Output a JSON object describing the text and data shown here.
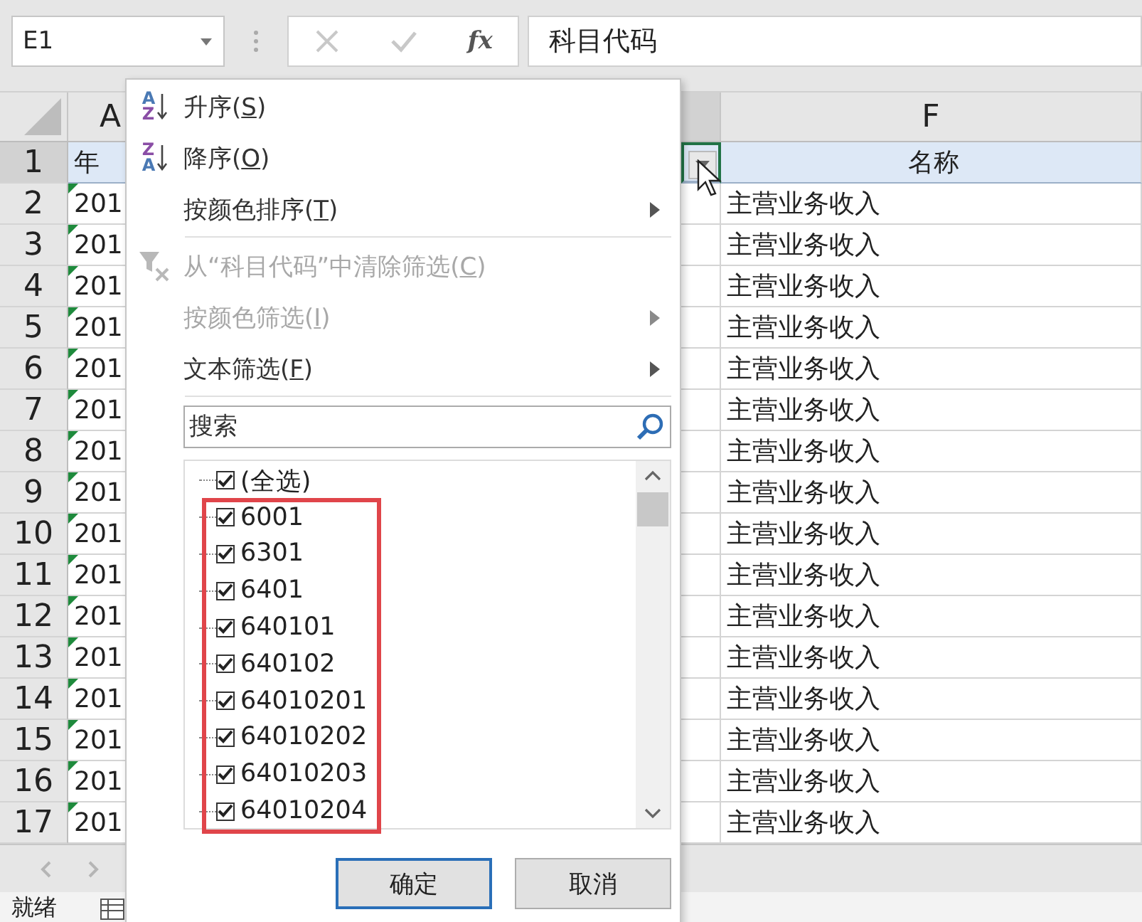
{
  "name_box": {
    "value": "E1"
  },
  "formula_bar": {
    "function_label": "fx",
    "value": "科目代码"
  },
  "columns": [
    {
      "name": "A",
      "selected": false
    },
    {
      "selected": true
    },
    {
      "name": "F",
      "selected": false
    }
  ],
  "rows": [
    {
      "number": "1",
      "selected": true,
      "col_a": "年",
      "col_a_flag": false,
      "col_f": "名称",
      "header": true
    },
    {
      "number": "2",
      "selected": false,
      "col_a": "201",
      "col_a_flag": true,
      "col_f": "主营业务收入",
      "header": false
    },
    {
      "number": "3",
      "selected": false,
      "col_a": "201",
      "col_a_flag": true,
      "col_f": "主营业务收入",
      "header": false
    },
    {
      "number": "4",
      "selected": false,
      "col_a": "201",
      "col_a_flag": true,
      "col_f": "主营业务收入",
      "header": false
    },
    {
      "number": "5",
      "selected": false,
      "col_a": "201",
      "col_a_flag": true,
      "col_f": "主营业务收入",
      "header": false
    },
    {
      "number": "6",
      "selected": false,
      "col_a": "201",
      "col_a_flag": true,
      "col_f": "主营业务收入",
      "header": false
    },
    {
      "number": "7",
      "selected": false,
      "col_a": "201",
      "col_a_flag": true,
      "col_f": "主营业务收入",
      "header": false
    },
    {
      "number": "8",
      "selected": false,
      "col_a": "201",
      "col_a_flag": true,
      "col_f": "主营业务收入",
      "header": false
    },
    {
      "number": "9",
      "selected": false,
      "col_a": "201",
      "col_a_flag": true,
      "col_f": "主营业务收入",
      "header": false
    },
    {
      "number": "10",
      "selected": false,
      "col_a": "201",
      "col_a_flag": true,
      "col_f": "主营业务收入",
      "header": false
    },
    {
      "number": "11",
      "selected": false,
      "col_a": "201",
      "col_a_flag": true,
      "col_f": "主营业务收入",
      "header": false
    },
    {
      "number": "12",
      "selected": false,
      "col_a": "201",
      "col_a_flag": true,
      "col_f": "主营业务收入",
      "header": false
    },
    {
      "number": "13",
      "selected": false,
      "col_a": "201",
      "col_a_flag": true,
      "col_f": "主营业务收入",
      "header": false
    },
    {
      "number": "14",
      "selected": false,
      "col_a": "201",
      "col_a_flag": true,
      "col_f": "主营业务收入",
      "header": false
    },
    {
      "number": "15",
      "selected": false,
      "col_a": "201",
      "col_a_flag": true,
      "col_f": "主营业务收入",
      "header": false
    },
    {
      "number": "16",
      "selected": false,
      "col_a": "201",
      "col_a_flag": true,
      "col_f": "主营业务收入",
      "header": false
    },
    {
      "number": "17",
      "selected": false,
      "col_a": "201",
      "col_a_flag": true,
      "col_f": "主营业务收入",
      "header": false
    }
  ],
  "filter_menu": {
    "items": [
      {
        "kind": "sort",
        "icon_top": "A",
        "icon_bottom": "Z",
        "label": "升序(",
        "accel": "S",
        "end": ")",
        "disabled": false,
        "submenu": false,
        "separator_after": false
      },
      {
        "kind": "sort",
        "icon_top": "Z",
        "icon_bottom": "A",
        "label": "降序(",
        "accel": "O",
        "end": ")",
        "disabled": false,
        "submenu": false,
        "separator_after": false
      },
      {
        "kind": "plain",
        "label": "按颜色排序(",
        "accel": "T",
        "end": ")",
        "disabled": false,
        "submenu": true,
        "separator_after": true
      },
      {
        "kind": "clear_filter",
        "label": "从“科目代码”中清除筛选(",
        "accel": "C",
        "end": ")",
        "disabled": true,
        "submenu": false,
        "separator_after": false
      },
      {
        "kind": "plain",
        "label": "按颜色筛选(",
        "accel": "I",
        "end": ")",
        "disabled": true,
        "submenu": true,
        "separator_after": false
      },
      {
        "kind": "plain",
        "label": "文本筛选(",
        "accel": "F",
        "end": ")",
        "disabled": false,
        "submenu": true,
        "separator_after": true
      }
    ],
    "search": {
      "placeholder": "搜索"
    },
    "values": [
      {
        "label": "(全选)",
        "checked": true
      },
      {
        "label": "6001",
        "checked": true
      },
      {
        "label": "6301",
        "checked": true
      },
      {
        "label": "6401",
        "checked": true
      },
      {
        "label": "640101",
        "checked": true
      },
      {
        "label": "640102",
        "checked": true
      },
      {
        "label": "64010201",
        "checked": true
      },
      {
        "label": "64010202",
        "checked": true
      },
      {
        "label": "64010203",
        "checked": true
      },
      {
        "label": "64010204",
        "checked": true
      }
    ],
    "buttons": [
      {
        "label": "确定",
        "default": true
      },
      {
        "label": "取消",
        "default": false
      }
    ]
  },
  "status_bar": {
    "text": "就绪"
  }
}
